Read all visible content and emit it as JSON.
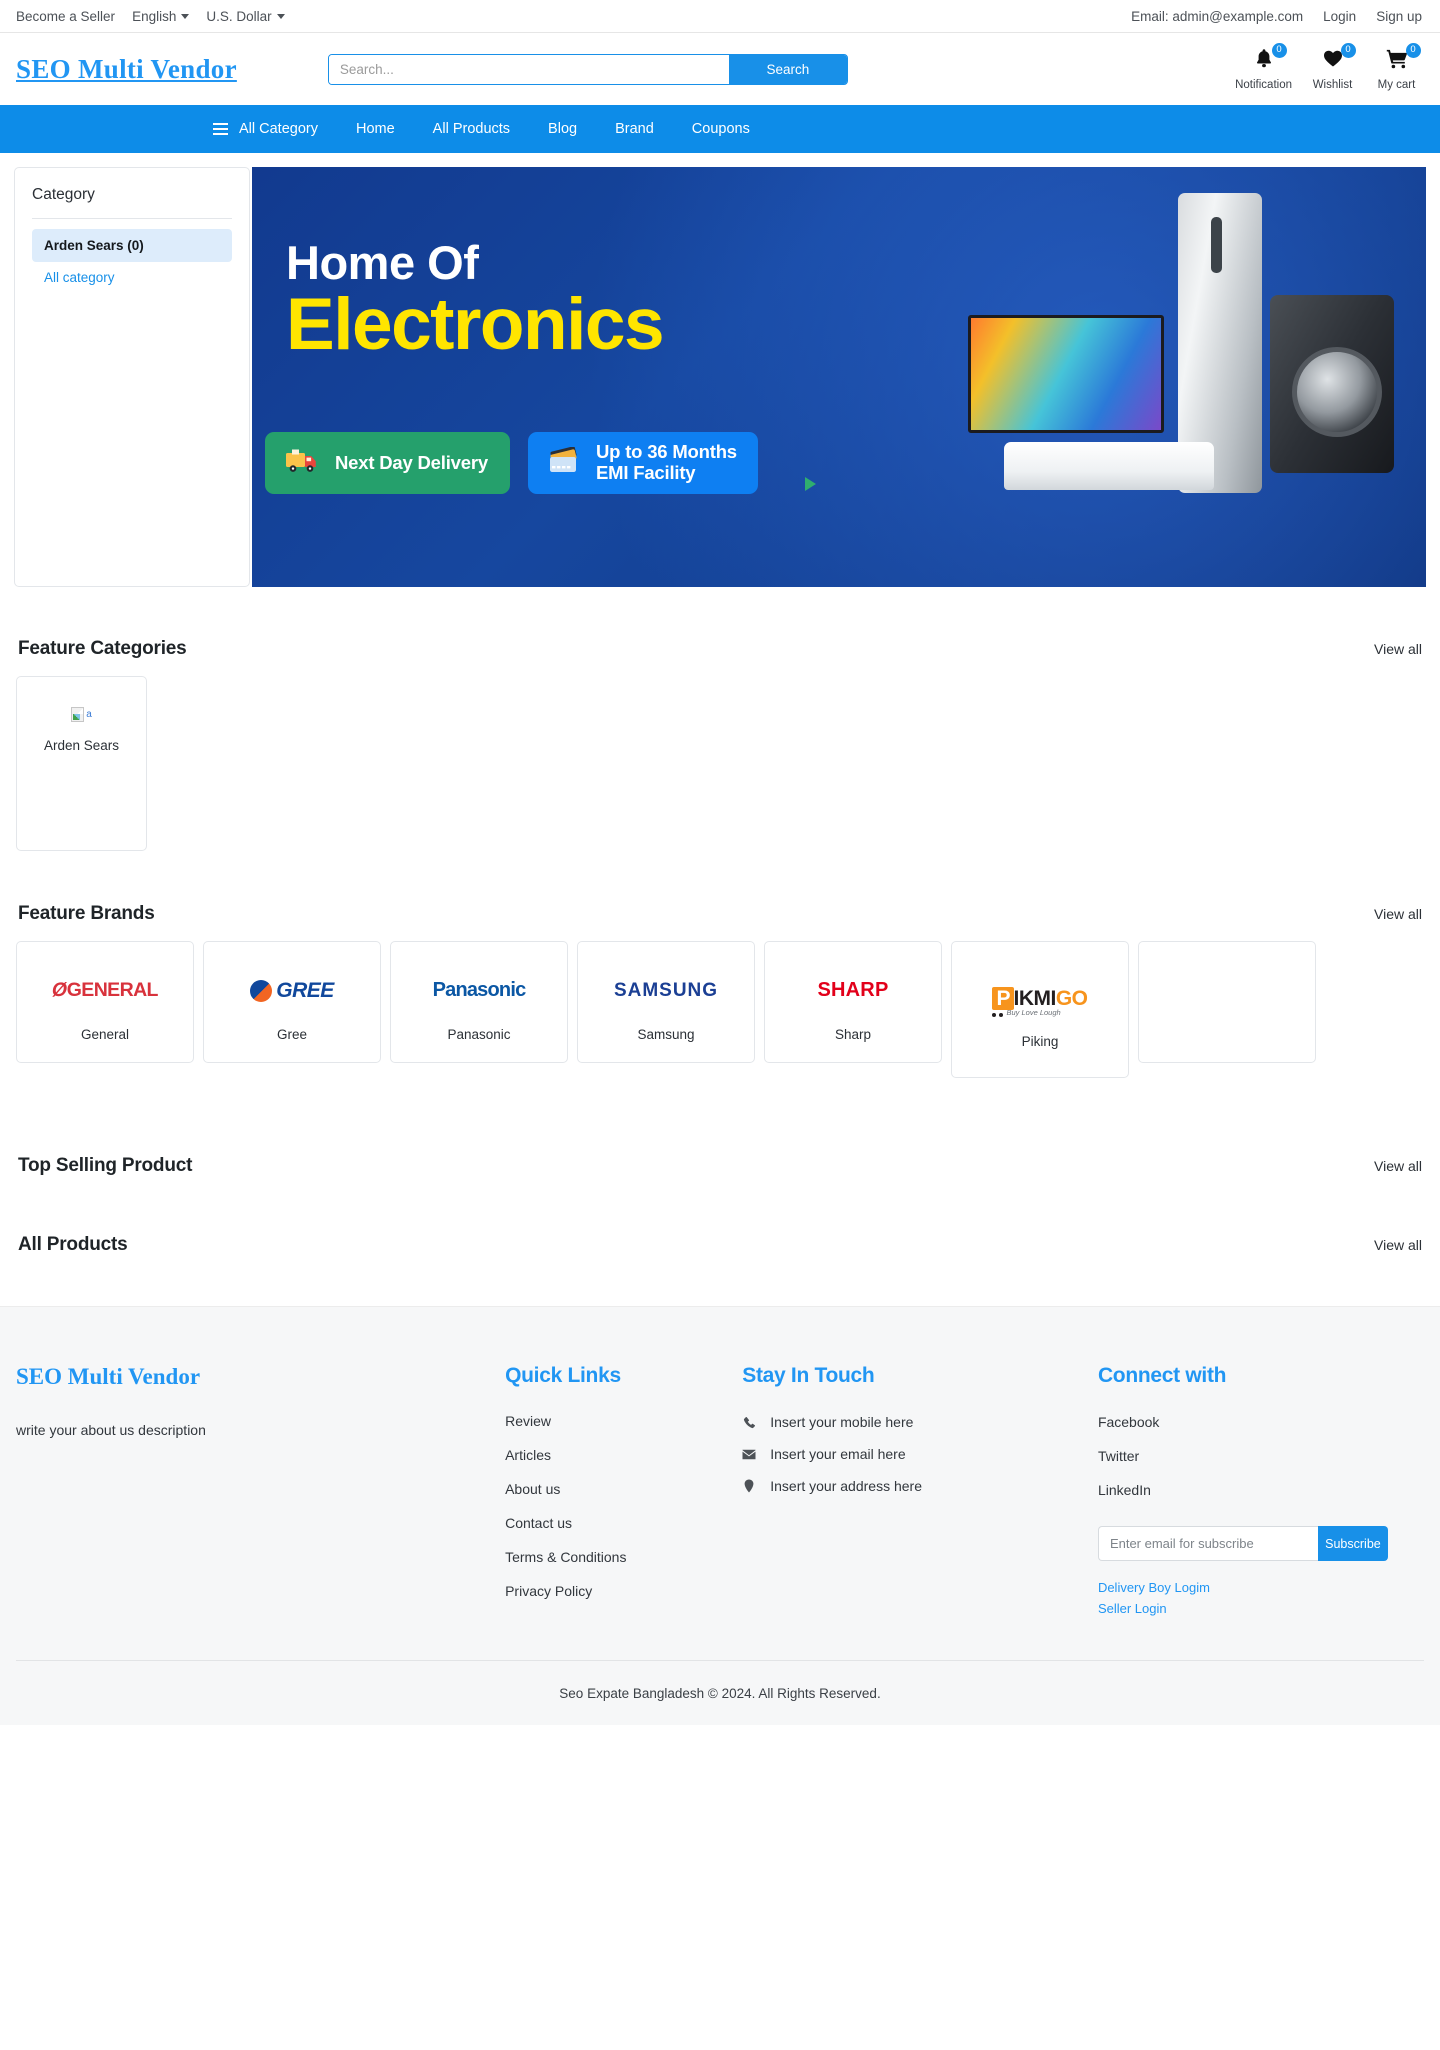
{
  "topbar": {
    "become_seller": "Become a Seller",
    "language": "English",
    "currency": "U.S. Dollar",
    "email": "Email: admin@example.com",
    "login": "Login",
    "signup": "Sign up"
  },
  "header": {
    "logo": "SEO Multi Vendor",
    "search_placeholder": "Search...",
    "search_value": "",
    "search_button": "Search",
    "icons": [
      {
        "name": "notification",
        "label": "Notification",
        "count": "0",
        "glyph": "🔔"
      },
      {
        "name": "wishlist",
        "label": "Wishlist",
        "count": "0",
        "glyph": "♥"
      },
      {
        "name": "cart",
        "label": "My cart",
        "count": "0",
        "glyph": "🛒"
      }
    ]
  },
  "nav": {
    "all_category": "All Category",
    "items": [
      "Home",
      "All Products",
      "Blog",
      "Brand",
      "Coupons"
    ]
  },
  "sidebar": {
    "title": "Category",
    "items": [
      {
        "label": "Arden Sears (0)",
        "active": true
      },
      {
        "label": "All category",
        "active": false
      }
    ]
  },
  "hero": {
    "line1": "Home Of",
    "line2": "Electronics",
    "badge_delivery": "Next Day Delivery",
    "badge_emi_line1": "Up to 36 Months",
    "badge_emi_line2": "EMI Facility",
    "prev_arrow": "‹",
    "next_arrow": "›"
  },
  "feature_categories": {
    "title": "Feature Categories",
    "view_all": "View all",
    "items": [
      {
        "name": "Arden Sears",
        "image_alt": "a"
      }
    ]
  },
  "feature_brands": {
    "title": "Feature Brands",
    "view_all": "View all",
    "items": [
      {
        "name": "General",
        "logo_text": "GENERAL"
      },
      {
        "name": "Gree",
        "logo_text": "GREE"
      },
      {
        "name": "Panasonic",
        "logo_text": "Panasonic"
      },
      {
        "name": "Samsung",
        "logo_text": "SAMSUNG"
      },
      {
        "name": "Sharp",
        "logo_text": "SHARP"
      },
      {
        "name": "Piking",
        "logo_text": "PIKMIGO",
        "logo_tagline": "Buy Love Lough"
      }
    ]
  },
  "top_selling": {
    "title": "Top Selling Product",
    "view_all": "View all"
  },
  "all_products": {
    "title": "All Products",
    "view_all": "View all"
  },
  "footer": {
    "brand": "SEO Multi Vendor",
    "description": "write your about us description",
    "quick_links": {
      "title": "Quick Links",
      "items": [
        "Review",
        "Articles",
        "About us",
        "Contact us",
        "Terms & Conditions",
        "Privacy Policy"
      ]
    },
    "stay_in_touch": {
      "title": "Stay In Touch",
      "items": [
        {
          "icon": "phone-icon",
          "text": "Insert your mobile here",
          "glyph": "☎"
        },
        {
          "icon": "envelope-icon",
          "text": "Insert your email here",
          "glyph": "✉"
        },
        {
          "icon": "location-pin-icon",
          "text": "Insert your address here",
          "glyph": "•"
        }
      ]
    },
    "connect_with": {
      "title": "Connect with",
      "socials": [
        "Facebook",
        "Twitter",
        "LinkedIn"
      ],
      "subscribe_placeholder": "Enter email for subscribe",
      "subscribe_value": "",
      "subscribe_button": "Subscribe",
      "delivery_login": "Delivery Boy Logim",
      "seller_login": "Seller Login"
    },
    "copyright": "Seo Expate Bangladesh © 2024. All Rights Reserved."
  },
  "colors": {
    "accent": "#1890e8",
    "nav_bg": "#0d8ce8",
    "brand_blue": "#2196f3",
    "hero_yellow": "#ffe500",
    "footer_bg": "#f6f7f8"
  }
}
